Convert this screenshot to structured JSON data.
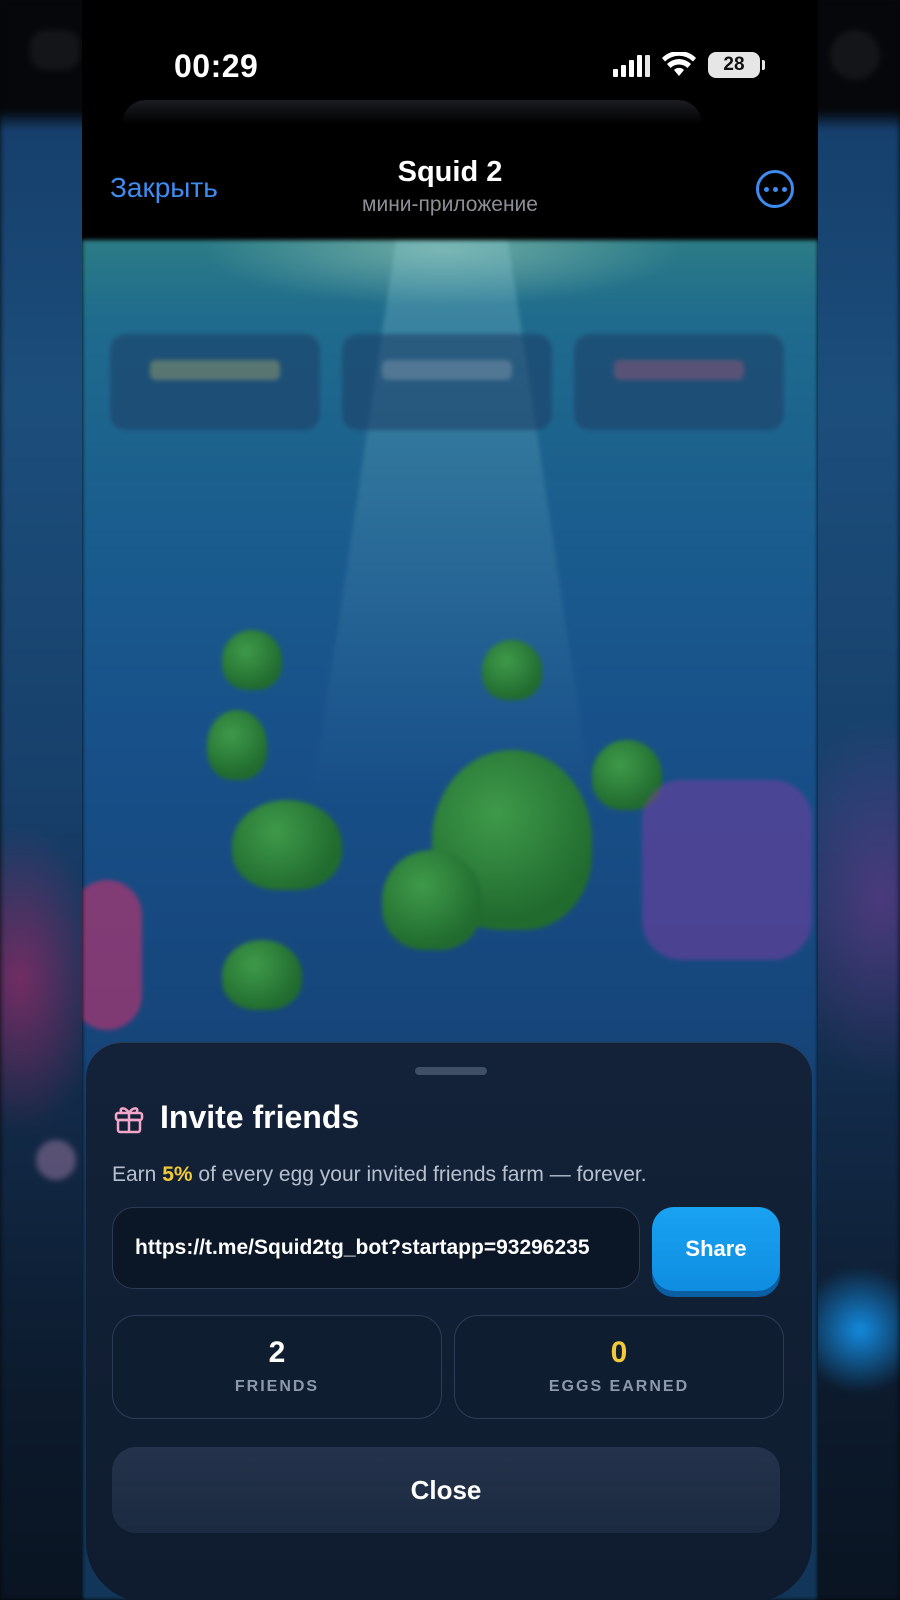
{
  "status_bar": {
    "time": "00:29",
    "battery": "28",
    "icons": [
      "signal-icon",
      "wifi-icon",
      "battery-icon"
    ]
  },
  "header": {
    "close_label": "Закрыть",
    "title": "Squid 2",
    "subtitle": "мини-приложение",
    "more_icon": "more-dots-icon"
  },
  "sheet": {
    "title": "Invite friends",
    "title_icon": "gift-icon",
    "description_prefix": "Earn ",
    "description_highlight": "5%",
    "description_suffix": " of every egg your invited friends farm — forever.",
    "referral_link": "https://t.me/Squid2tg_bot?startapp=93296235",
    "share_label": "Share",
    "stats": [
      {
        "value": "2",
        "label": "FRIENDS"
      },
      {
        "value": "0",
        "label": "EGGS EARNED"
      }
    ],
    "close_label": "Close"
  },
  "colors": {
    "accent_blue": "#3e8cf0",
    "share_blue": "#1aa2f2",
    "highlight_gold": "#f2c93a",
    "sheet_bg": "#132238"
  }
}
